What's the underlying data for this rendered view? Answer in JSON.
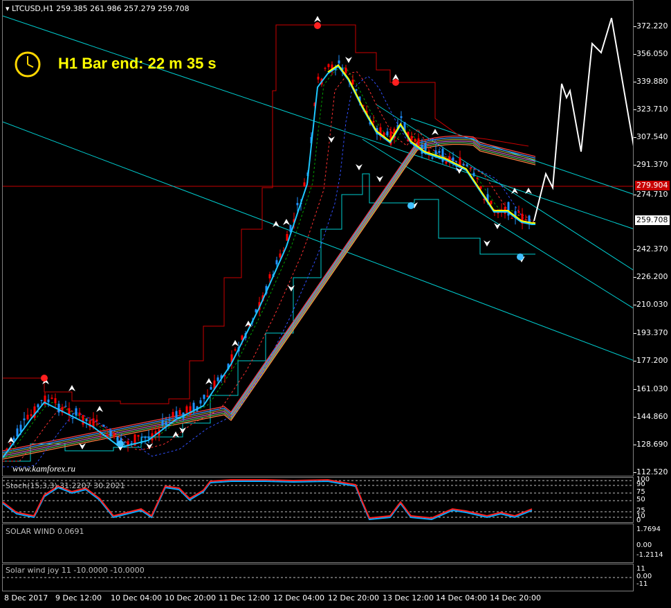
{
  "header": {
    "symbol_line": "LTCUSD,H1  259.385 261.986 257.279 259.708"
  },
  "timer": {
    "text": "H1 Bar end: 22 m 35 s",
    "icon": "clock-icon",
    "color": "#ffff00"
  },
  "watermark": "www.kamforex.ru",
  "price_axis": {
    "ticks": [
      "372.220",
      "356.050",
      "339.880",
      "323.710",
      "307.540",
      "291.370",
      "274.710",
      "242.370",
      "226.200",
      "210.030",
      "193.370",
      "177.200",
      "161.030",
      "144.860",
      "128.690",
      "112.520"
    ],
    "current_price": "259.708",
    "level_price": "279.904",
    "level_color": "#c80000"
  },
  "stoch": {
    "label": "Stoch(15,3,3) 31.2207 30.2021",
    "ticks": [
      "100",
      "90",
      "75",
      "50",
      "25",
      "10",
      "0"
    ]
  },
  "solar": {
    "label": "SOLAR WIND 0.0691",
    "ticks": [
      "1.7694",
      "0.00",
      "-1.2114"
    ]
  },
  "solar_joy": {
    "label": "Solar wind joy 11 -10.0000 -10.0000",
    "ticks": [
      "11",
      "0.00",
      "-11"
    ]
  },
  "time_axis": [
    "8 Dec 2017",
    "9 Dec 12:00",
    "10 Dec 04:00",
    "10 Dec 20:00",
    "11 Dec 12:00",
    "12 Dec 04:00",
    "12 Dec 20:00",
    "13 Dec 12:00",
    "14 Dec 04:00",
    "14 Dec 20:00"
  ],
  "colors": {
    "bull_candle": "#1e90ff",
    "bear_candle": "#ff0000",
    "channel": "#00ced1",
    "fast_ma": "#ffff00",
    "projection": "#ffffff"
  }
}
